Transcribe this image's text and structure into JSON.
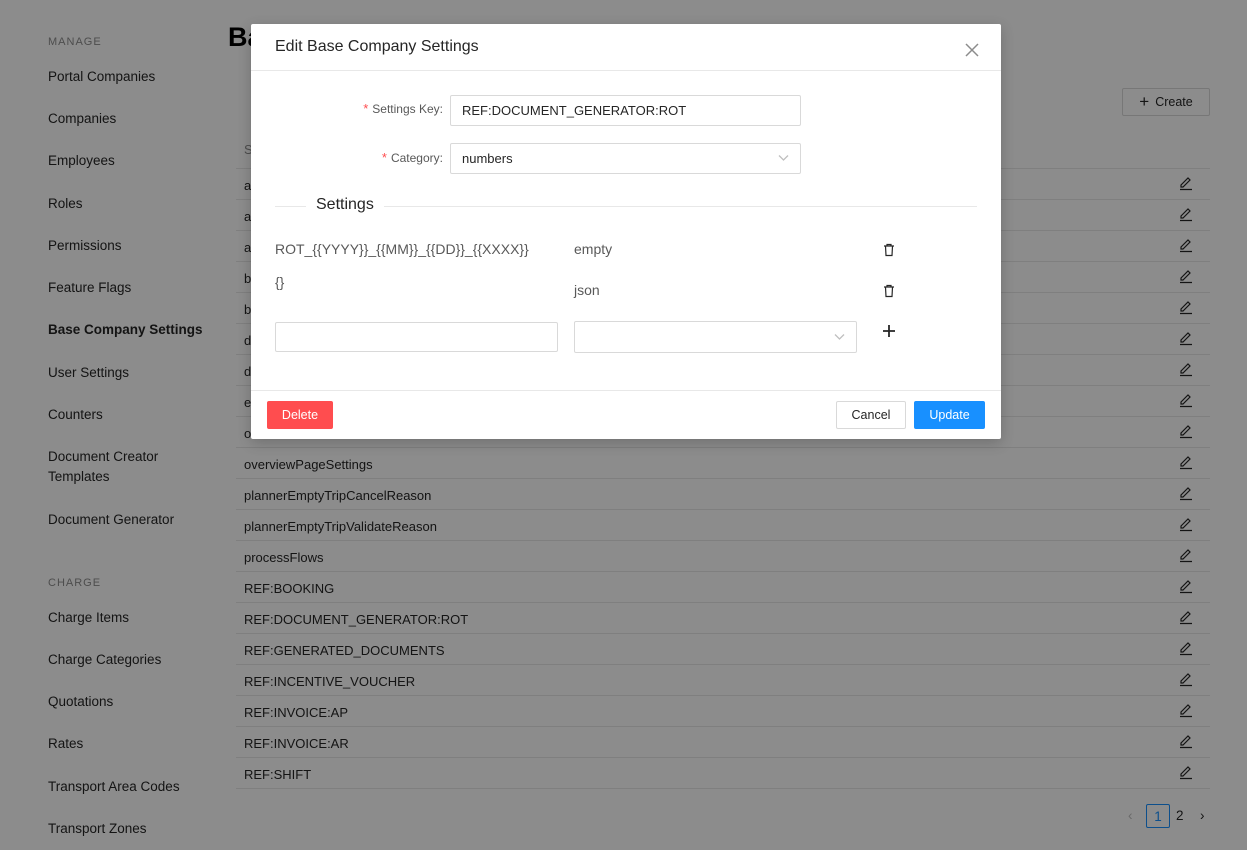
{
  "sidebar": {
    "sections": [
      {
        "title": "MANAGE",
        "items": [
          {
            "label": "Portal Companies",
            "active": false
          },
          {
            "label": "Companies",
            "active": false
          },
          {
            "label": "Employees",
            "active": false
          },
          {
            "label": "Roles",
            "active": false
          },
          {
            "label": "Permissions",
            "active": false
          },
          {
            "label": "Feature Flags",
            "active": false
          },
          {
            "label": "Base Company Settings",
            "active": true
          },
          {
            "label": "User Settings",
            "active": false
          },
          {
            "label": "Counters",
            "active": false
          },
          {
            "label": "Document Creator Templates",
            "active": false
          },
          {
            "label": "Document Generator",
            "active": false
          }
        ]
      },
      {
        "title": "CHARGE",
        "items": [
          {
            "label": "Charge Items",
            "active": false
          },
          {
            "label": "Charge Categories",
            "active": false
          },
          {
            "label": "Quotations",
            "active": false
          },
          {
            "label": "Rates",
            "active": false
          },
          {
            "label": "Transport Area Codes",
            "active": false
          },
          {
            "label": "Transport Zones",
            "active": false
          }
        ]
      }
    ]
  },
  "page": {
    "title": "Ba",
    "create_label": "Create",
    "column_header": "S",
    "rows": [
      "a",
      "a",
      "a",
      "b",
      "b",
      "d",
      "d",
      "e",
      "o",
      "overviewPageSettings",
      "plannerEmptyTripCancelReason",
      "plannerEmptyTripValidateReason",
      "processFlows",
      "REF:BOOKING",
      "REF:DOCUMENT_GENERATOR:ROT",
      "REF:GENERATED_DOCUMENTS",
      "REF:INCENTIVE_VOUCHER",
      "REF:INVOICE:AP",
      "REF:INVOICE:AR",
      "REF:SHIFT"
    ],
    "pagination": {
      "current": "1",
      "next_page": "2"
    }
  },
  "modal": {
    "title": "Edit Base Company Settings",
    "settings_key_label": "Settings Key",
    "settings_key_value": "REF:DOCUMENT_GENERATOR:ROT",
    "category_label": "Category",
    "category_value": "numbers",
    "settings_divider": "Settings",
    "settings": [
      {
        "key": "ROT_{{YYYY}}_{{MM}}_{{DD}}_{{XXXX}}",
        "type": "empty"
      },
      {
        "key": "{}",
        "type": "json"
      }
    ],
    "new_key_value": "",
    "new_type_value": "",
    "delete_label": "Delete",
    "cancel_label": "Cancel",
    "update_label": "Update"
  },
  "colors": {
    "primary": "#1890ff",
    "danger": "#ff4d4f",
    "required": "#ff4d4f",
    "overlay": "rgba(0,0,0,0.45)"
  },
  "icons": {
    "close": "close-icon",
    "edit": "edit-icon",
    "trash": "trash-icon",
    "plus": "plus-icon",
    "chevron": "chevron-down-icon"
  }
}
